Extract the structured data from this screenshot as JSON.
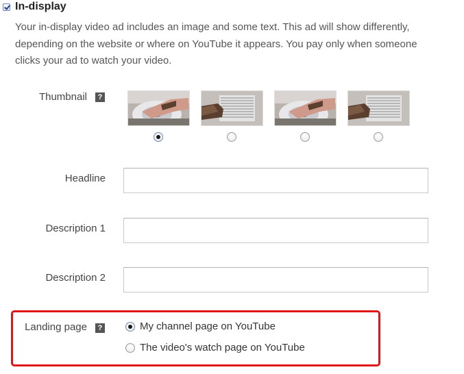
{
  "header": {
    "title": "In-display",
    "checked": true
  },
  "description": "Your in-display video ad includes an image and some text. This ad will show differently, depending on the website or where on YouTube it appears. You pay only when someone clicks your ad to watch your video.",
  "help_icon_glyph": "?",
  "thumbnail": {
    "label": "Thumbnail",
    "options": [
      {
        "scene": "hand-on-saw-blade",
        "selected": true
      },
      {
        "scene": "glove-on-grille",
        "selected": false
      },
      {
        "scene": "hand-on-saw-blade",
        "selected": false
      },
      {
        "scene": "glove-on-grille",
        "selected": false
      }
    ]
  },
  "fields": {
    "headline": {
      "label": "Headline",
      "value": ""
    },
    "description1": {
      "label": "Description 1",
      "value": ""
    },
    "description2": {
      "label": "Description 2",
      "value": ""
    }
  },
  "landing_page": {
    "label": "Landing page",
    "options": [
      {
        "label": "My channel page on YouTube",
        "selected": true
      },
      {
        "label": "The video's watch page on YouTube",
        "selected": false
      }
    ],
    "highlight_color": "#e01414"
  }
}
